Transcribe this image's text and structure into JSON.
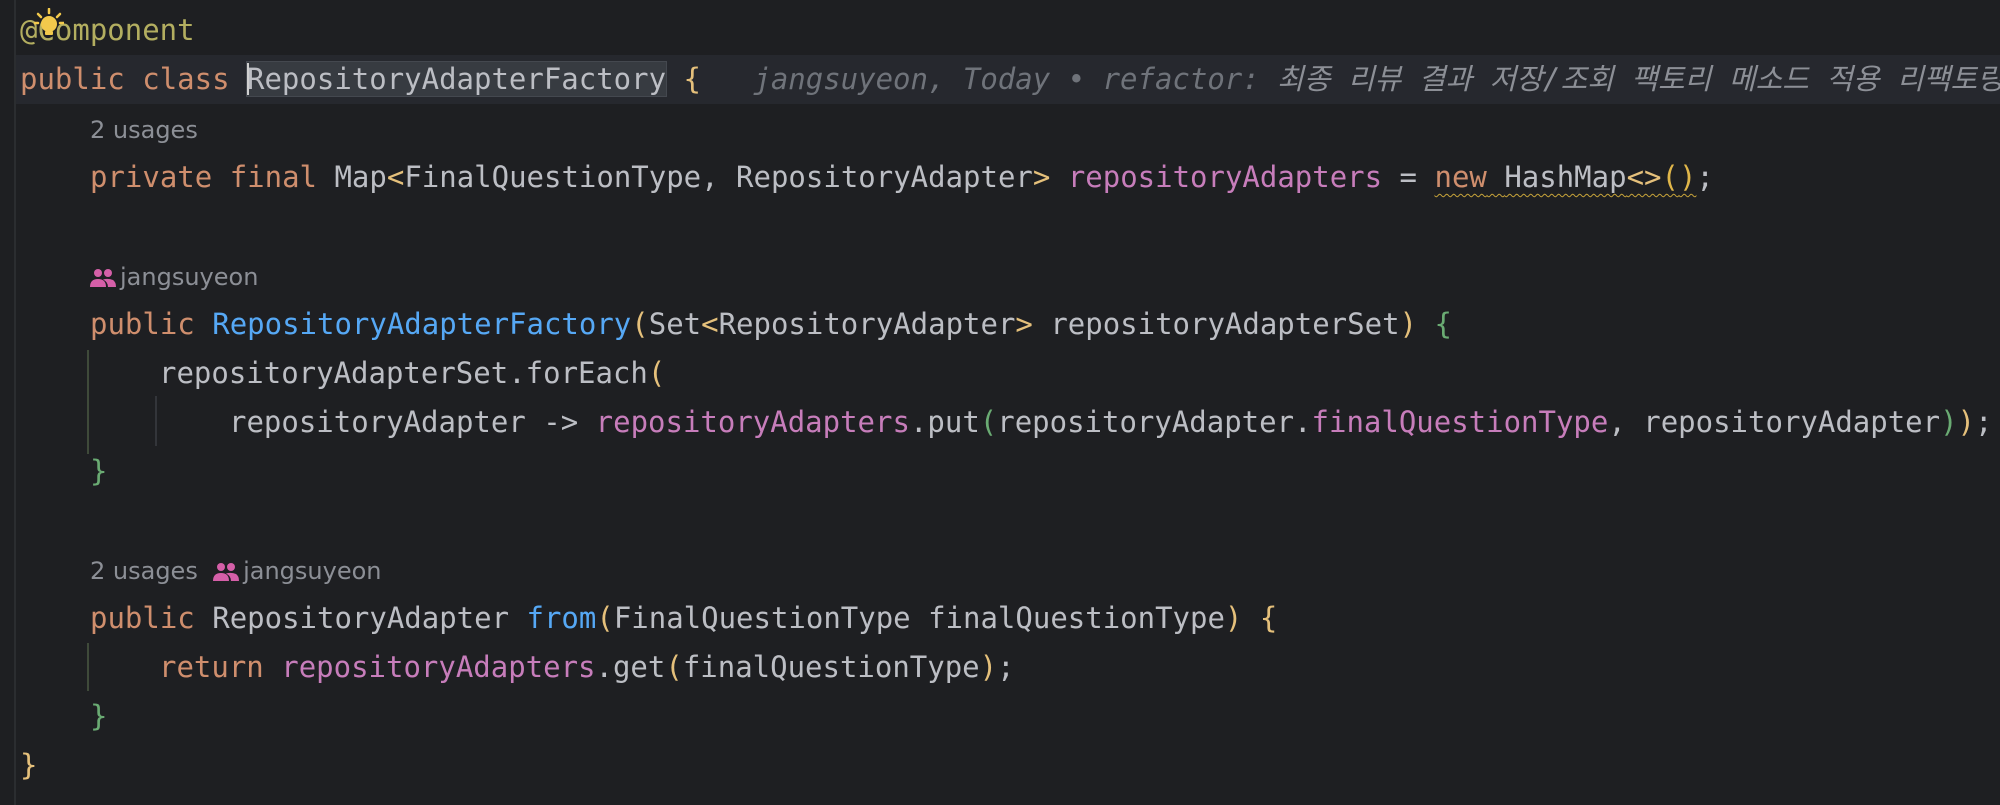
{
  "code": {
    "annotation": "@Component",
    "class_line": {
      "kw_public": "public",
      "kw_class": "class",
      "class_name": "RepositoryAdapterFactory",
      "brace": "{"
    },
    "blame": {
      "author_date": "jangsuyeon, Today • refactor:",
      "message": " 최종 리뷰 결과 저장/조회 팩토리 메소드 적용 리팩토링 ("
    },
    "field_hint": "2 usages",
    "field": {
      "kw_private": "private",
      "kw_final": "final",
      "map": "Map",
      "lt": "<",
      "type_args": "FinalQuestionType, RepositoryAdapter",
      "gt": ">",
      "name": "repositoryAdapters",
      "eq": " = ",
      "kw_new": "new",
      "hashmap": "HashMap",
      "diamond": "<>",
      "paren_open": "(",
      "paren_close": ")",
      "semi": ";"
    },
    "ctor_hint_author": "jangsuyeon",
    "ctor": {
      "kw_public": "public",
      "name": "RepositoryAdapterFactory",
      "paren_open": "(",
      "set": "Set",
      "lt": "<",
      "type_arg": "RepositoryAdapter",
      "gt": ">",
      "param": " repositoryAdapterSet",
      "paren_close": ")",
      "brace_open": "{",
      "foreach_call": "repositoryAdapterSet.forEach",
      "foreach_paren": "(",
      "lambda_param": "repositoryAdapter -> ",
      "field_ref": "repositoryAdapters",
      "put": ".put",
      "put_paren_open": "(",
      "arg_obj": "repositoryAdapter.",
      "arg_field": "finalQuestionType",
      "arg_rest": ", repositoryAdapter",
      "put_paren_close": ")",
      "foreach_paren_close": ")",
      "semi": ";",
      "brace_close": "}"
    },
    "method_hint_usages": "2 usages",
    "method_hint_author": "jangsuyeon",
    "method": {
      "kw_public": "public",
      "return_type": "RepositoryAdapter",
      "name": "from",
      "paren_open": "(",
      "params": "FinalQuestionType finalQuestionType",
      "paren_close": ")",
      "brace_open": "{",
      "kw_return": "return",
      "field_ref": "repositoryAdapters",
      "get": ".get",
      "get_paren_open": "(",
      "get_arg": "finalQuestionType",
      "get_paren_close": ")",
      "semi": ";",
      "brace_close": "}"
    },
    "class_close": "}"
  },
  "colors": {
    "background": "#1e1f22",
    "keyword": "#cf8e6d",
    "field": "#c77dbb",
    "function": "#56a8f5",
    "annotation": "#b3ae60",
    "inlay_hint": "#8c8f96"
  },
  "icons": {
    "intention": "lightbulb-icon",
    "author": "people-icon"
  }
}
